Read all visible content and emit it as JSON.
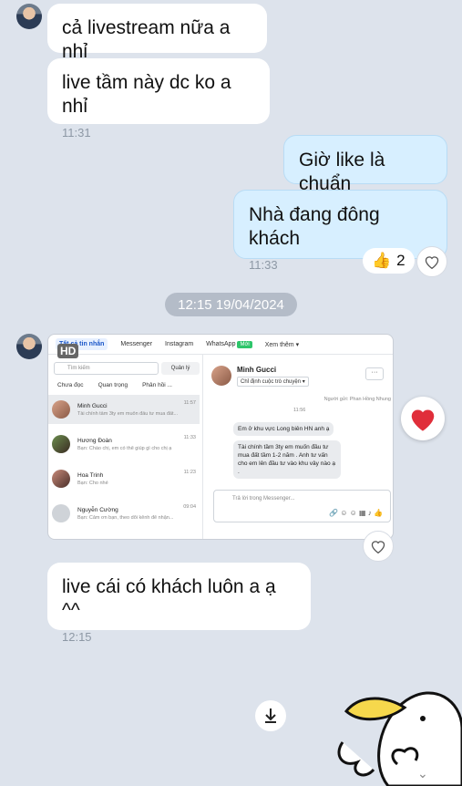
{
  "messages": [
    {
      "text": "cả livestream nữa a nhỉ"
    },
    {
      "text": "live tầm này dc ko a nhỉ",
      "time": "11:31"
    },
    {
      "text": "Giờ like là chuẩn"
    },
    {
      "text": "Nhà đang đông khách",
      "time": "11:33"
    },
    {
      "text": "live cái có khách luôn a ạ ^^",
      "time": "12:15"
    }
  ],
  "reaction": {
    "emoji": "👍",
    "count": "2"
  },
  "date_separator": "12:15 19/04/2024",
  "screenshot": {
    "hd_label": "HD",
    "tabs": [
      "Tất cả tin nhắn",
      "Messenger",
      "Instagram",
      "WhatsApp",
      "Xem thêm"
    ],
    "new_badge": "Mới",
    "search_placeholder": "Tìm kiếm",
    "manage_label": "Quản lý",
    "filters": [
      "Chưa đọc",
      "Quan trọng",
      "Phân hồi ..."
    ],
    "conversations": [
      {
        "name": "Minh Gucci",
        "preview": "Tài chính tầm 3ty em muốn đầu tư mua đất...",
        "time": "11:57"
      },
      {
        "name": "Hương Đoàn",
        "preview": "Bạn: Chào chị, em có thể giúp gì cho chị ạ",
        "time": "11:33"
      },
      {
        "name": "Hoa Trinh",
        "preview": "Bạn: Cho nhé",
        "time": "11:23"
      },
      {
        "name": "Nguyễn Cường",
        "preview": "Bạn: Cảm ơn bạn, theo dõi kênh để nhận...",
        "time": "09:04"
      }
    ],
    "chat": {
      "name": "Minh Gucci",
      "assign": "Chỉ định cuộc trò chuyện",
      "sent_by": "Người gửi: Phan Hồng Nhung",
      "time": "11:56",
      "msg1": "Em ở khu vực Long biên HN anh ạ",
      "msg2": "Tài chính tầm 3ty em muốn đầu tư mua đất tầm 1-2 năm . Anh tư vấn cho em lên đầu tư vào khu vây nào ạ .",
      "reply_placeholder": "Trả lời trong Messenger..."
    }
  },
  "colors": {
    "background": "#dde3ec",
    "my_bubble": "#d7efff",
    "heart": "#e02e3a"
  }
}
